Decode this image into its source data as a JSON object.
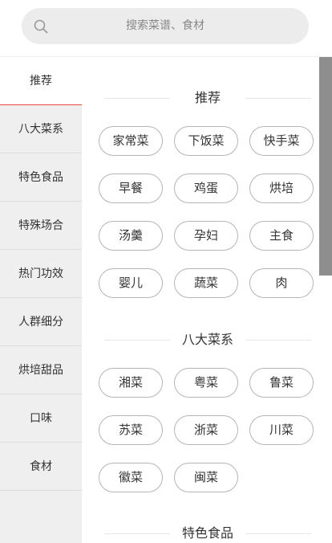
{
  "search": {
    "placeholder": "搜索菜谱、食材",
    "icon": "search-icon"
  },
  "sidebar": {
    "items": [
      {
        "label": "推荐",
        "active": true
      },
      {
        "label": "八大菜系",
        "active": false
      },
      {
        "label": "特色食品",
        "active": false
      },
      {
        "label": "特殊场合",
        "active": false
      },
      {
        "label": "热门功效",
        "active": false
      },
      {
        "label": "人群细分",
        "active": false
      },
      {
        "label": "烘培甜品",
        "active": false
      },
      {
        "label": "口味",
        "active": false
      },
      {
        "label": "食材",
        "active": false
      }
    ],
    "active_color": "#e64340"
  },
  "sections": [
    {
      "title": "推荐",
      "tags": [
        "家常菜",
        "下饭菜",
        "快手菜",
        "早餐",
        "鸡蛋",
        "烘培",
        "汤羹",
        "孕妇",
        "主食",
        "婴儿",
        "蔬菜",
        "肉"
      ]
    },
    {
      "title": "八大菜系",
      "tags": [
        "湘菜",
        "粤菜",
        "鲁菜",
        "苏菜",
        "浙菜",
        "川菜",
        "徽菜",
        "闽菜"
      ]
    },
    {
      "title": "特色食品",
      "tags": []
    }
  ],
  "scrollbar": {
    "thumb_color": "#8e8e8e",
    "scroll_fraction": 0.0
  }
}
